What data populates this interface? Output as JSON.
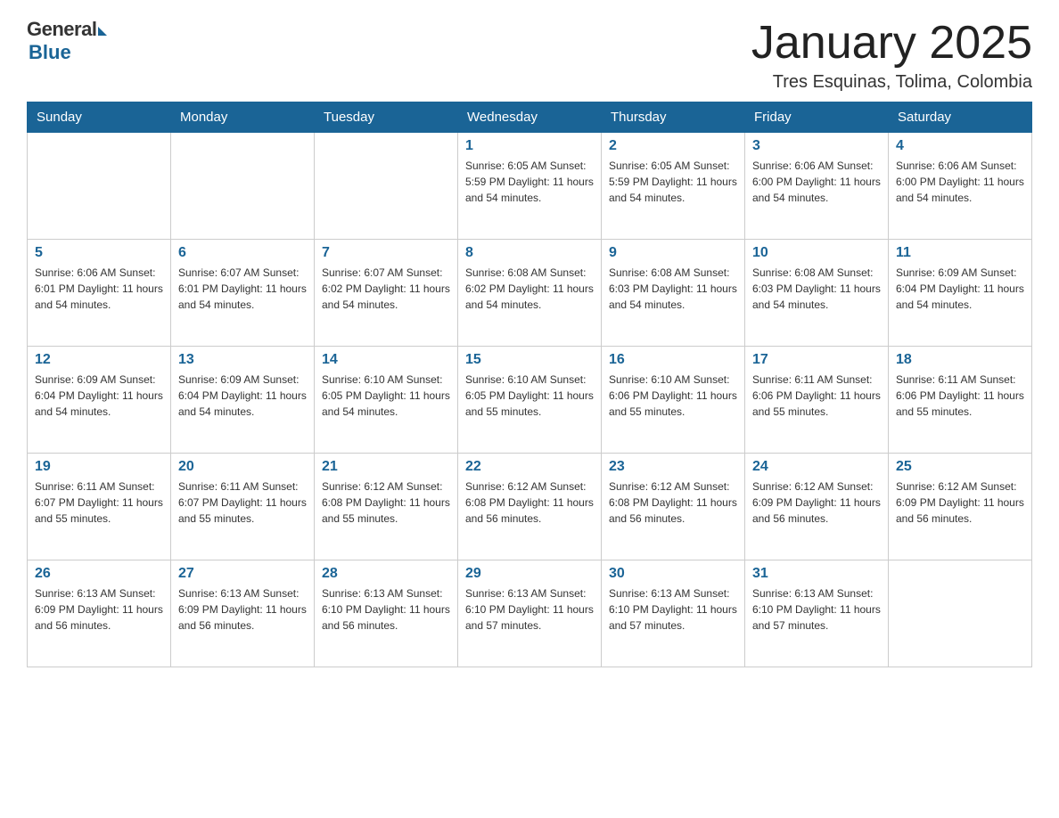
{
  "header": {
    "logo_general": "General",
    "logo_blue": "Blue",
    "title": "January 2025",
    "location": "Tres Esquinas, Tolima, Colombia"
  },
  "days_of_week": [
    "Sunday",
    "Monday",
    "Tuesday",
    "Wednesday",
    "Thursday",
    "Friday",
    "Saturday"
  ],
  "weeks": [
    [
      {
        "day": "",
        "info": ""
      },
      {
        "day": "",
        "info": ""
      },
      {
        "day": "",
        "info": ""
      },
      {
        "day": "1",
        "info": "Sunrise: 6:05 AM\nSunset: 5:59 PM\nDaylight: 11 hours and 54 minutes."
      },
      {
        "day": "2",
        "info": "Sunrise: 6:05 AM\nSunset: 5:59 PM\nDaylight: 11 hours and 54 minutes."
      },
      {
        "day": "3",
        "info": "Sunrise: 6:06 AM\nSunset: 6:00 PM\nDaylight: 11 hours and 54 minutes."
      },
      {
        "day": "4",
        "info": "Sunrise: 6:06 AM\nSunset: 6:00 PM\nDaylight: 11 hours and 54 minutes."
      }
    ],
    [
      {
        "day": "5",
        "info": "Sunrise: 6:06 AM\nSunset: 6:01 PM\nDaylight: 11 hours and 54 minutes."
      },
      {
        "day": "6",
        "info": "Sunrise: 6:07 AM\nSunset: 6:01 PM\nDaylight: 11 hours and 54 minutes."
      },
      {
        "day": "7",
        "info": "Sunrise: 6:07 AM\nSunset: 6:02 PM\nDaylight: 11 hours and 54 minutes."
      },
      {
        "day": "8",
        "info": "Sunrise: 6:08 AM\nSunset: 6:02 PM\nDaylight: 11 hours and 54 minutes."
      },
      {
        "day": "9",
        "info": "Sunrise: 6:08 AM\nSunset: 6:03 PM\nDaylight: 11 hours and 54 minutes."
      },
      {
        "day": "10",
        "info": "Sunrise: 6:08 AM\nSunset: 6:03 PM\nDaylight: 11 hours and 54 minutes."
      },
      {
        "day": "11",
        "info": "Sunrise: 6:09 AM\nSunset: 6:04 PM\nDaylight: 11 hours and 54 minutes."
      }
    ],
    [
      {
        "day": "12",
        "info": "Sunrise: 6:09 AM\nSunset: 6:04 PM\nDaylight: 11 hours and 54 minutes."
      },
      {
        "day": "13",
        "info": "Sunrise: 6:09 AM\nSunset: 6:04 PM\nDaylight: 11 hours and 54 minutes."
      },
      {
        "day": "14",
        "info": "Sunrise: 6:10 AM\nSunset: 6:05 PM\nDaylight: 11 hours and 54 minutes."
      },
      {
        "day": "15",
        "info": "Sunrise: 6:10 AM\nSunset: 6:05 PM\nDaylight: 11 hours and 55 minutes."
      },
      {
        "day": "16",
        "info": "Sunrise: 6:10 AM\nSunset: 6:06 PM\nDaylight: 11 hours and 55 minutes."
      },
      {
        "day": "17",
        "info": "Sunrise: 6:11 AM\nSunset: 6:06 PM\nDaylight: 11 hours and 55 minutes."
      },
      {
        "day": "18",
        "info": "Sunrise: 6:11 AM\nSunset: 6:06 PM\nDaylight: 11 hours and 55 minutes."
      }
    ],
    [
      {
        "day": "19",
        "info": "Sunrise: 6:11 AM\nSunset: 6:07 PM\nDaylight: 11 hours and 55 minutes."
      },
      {
        "day": "20",
        "info": "Sunrise: 6:11 AM\nSunset: 6:07 PM\nDaylight: 11 hours and 55 minutes."
      },
      {
        "day": "21",
        "info": "Sunrise: 6:12 AM\nSunset: 6:08 PM\nDaylight: 11 hours and 55 minutes."
      },
      {
        "day": "22",
        "info": "Sunrise: 6:12 AM\nSunset: 6:08 PM\nDaylight: 11 hours and 56 minutes."
      },
      {
        "day": "23",
        "info": "Sunrise: 6:12 AM\nSunset: 6:08 PM\nDaylight: 11 hours and 56 minutes."
      },
      {
        "day": "24",
        "info": "Sunrise: 6:12 AM\nSunset: 6:09 PM\nDaylight: 11 hours and 56 minutes."
      },
      {
        "day": "25",
        "info": "Sunrise: 6:12 AM\nSunset: 6:09 PM\nDaylight: 11 hours and 56 minutes."
      }
    ],
    [
      {
        "day": "26",
        "info": "Sunrise: 6:13 AM\nSunset: 6:09 PM\nDaylight: 11 hours and 56 minutes."
      },
      {
        "day": "27",
        "info": "Sunrise: 6:13 AM\nSunset: 6:09 PM\nDaylight: 11 hours and 56 minutes."
      },
      {
        "day": "28",
        "info": "Sunrise: 6:13 AM\nSunset: 6:10 PM\nDaylight: 11 hours and 56 minutes."
      },
      {
        "day": "29",
        "info": "Sunrise: 6:13 AM\nSunset: 6:10 PM\nDaylight: 11 hours and 57 minutes."
      },
      {
        "day": "30",
        "info": "Sunrise: 6:13 AM\nSunset: 6:10 PM\nDaylight: 11 hours and 57 minutes."
      },
      {
        "day": "31",
        "info": "Sunrise: 6:13 AM\nSunset: 6:10 PM\nDaylight: 11 hours and 57 minutes."
      },
      {
        "day": "",
        "info": ""
      }
    ]
  ]
}
